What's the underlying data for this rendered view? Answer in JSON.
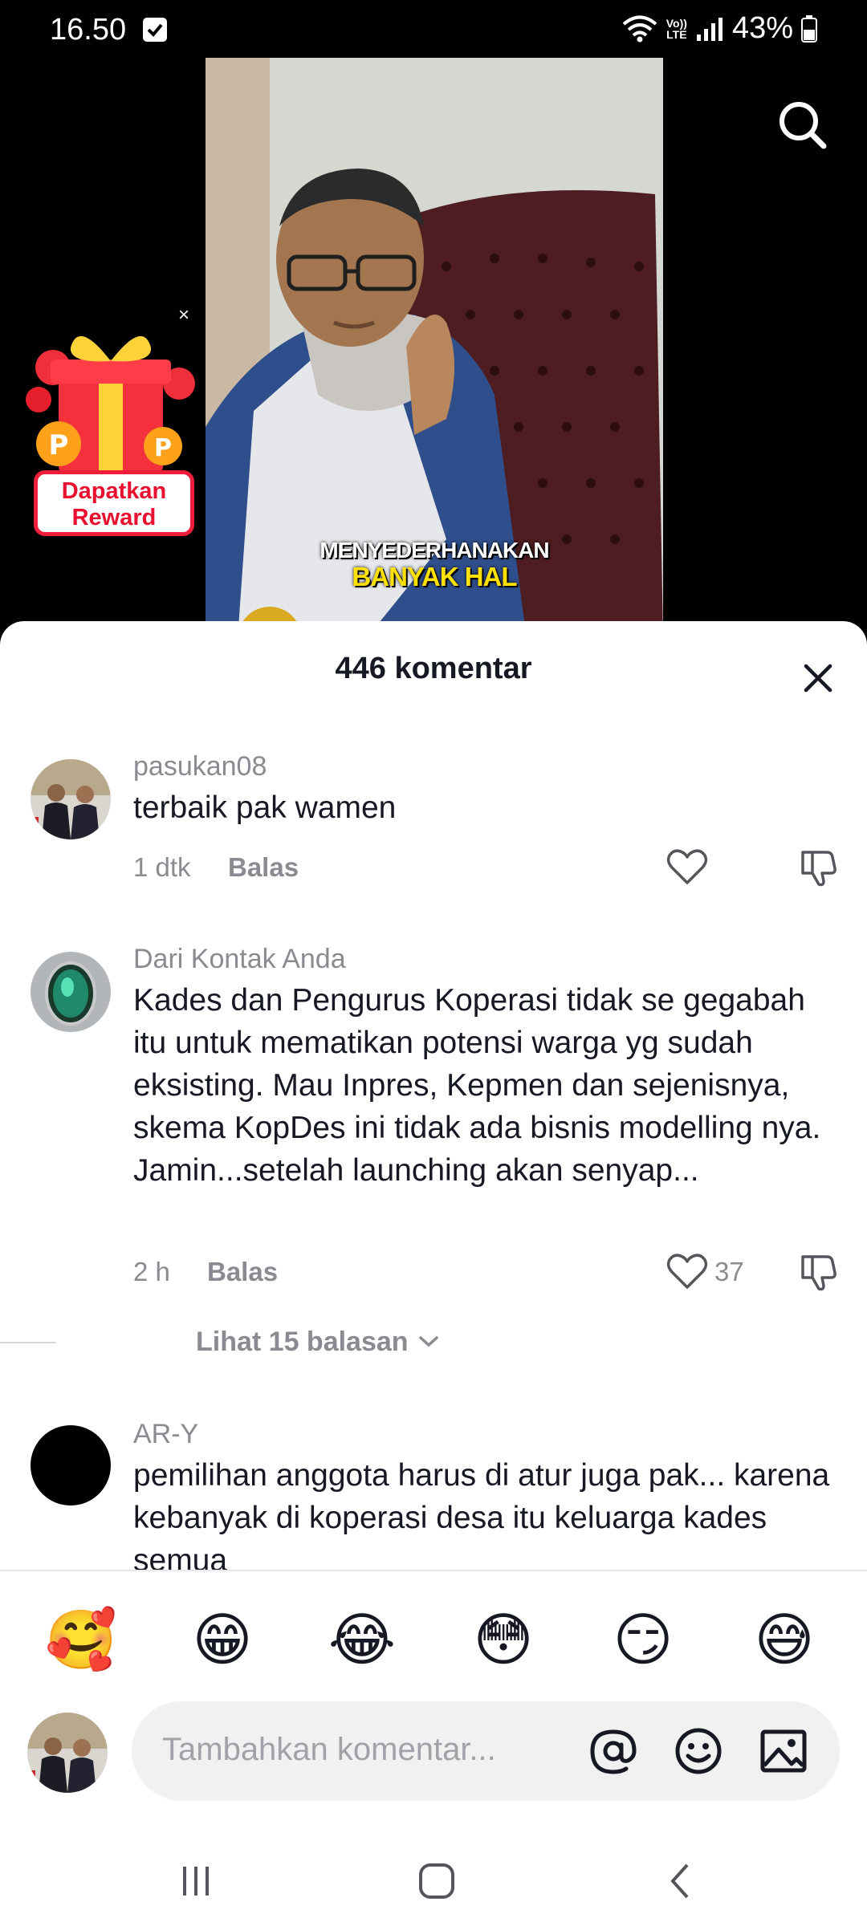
{
  "status_bar": {
    "time": "16.50",
    "volte_top": "Vo))",
    "volte_bottom": "LTE",
    "battery": "43%"
  },
  "video": {
    "caption_line1": "MENYEDERHANAKAN",
    "caption_line2": "BANYAK HAL",
    "search_icon": "search-icon"
  },
  "reward_widget": {
    "label_line1": "Dapatkan",
    "label_line2": "Reward",
    "close": "×"
  },
  "comments_sheet": {
    "title": "446 komentar",
    "comments": [
      {
        "username": "pasukan08",
        "text": "terbaik pak wamen",
        "time": "1 dtk",
        "reply_label": "Balas",
        "likes": ""
      },
      {
        "username": "Dari Kontak Anda",
        "text": "Kades dan Pengurus Koperasi tidak se gegabah itu untuk mematikan potensi warga yg sudah eksisting. Mau Inpres, Kepmen dan sejenisnya, skema KopDes ini tidak ada bisnis modelling nya. Jamin...setelah launching akan senyap...",
        "time": "2 h",
        "reply_label": "Balas",
        "likes": "37",
        "view_replies": "Lihat 15 balasan"
      },
      {
        "username": "AR-Y",
        "text": "pemilihan anggota harus di atur juga pak... karena kebanyak di koperasi desa itu keluarga kades semua"
      }
    ]
  },
  "quick_emojis": [
    "🥰",
    "😁",
    "😂",
    "😳",
    "😏",
    "😅"
  ],
  "composer": {
    "placeholder": "Tambahkan komentar...",
    "mention_icon": "at-icon",
    "emoji_icon": "smiley-icon",
    "image_icon": "image-icon"
  },
  "colors": {
    "sheet_bg": "#ffffff",
    "muted_text": "#8a8b91",
    "primary_text": "#161823",
    "caption_yellow": "#ffe100",
    "reward_red": "#e8102e"
  }
}
